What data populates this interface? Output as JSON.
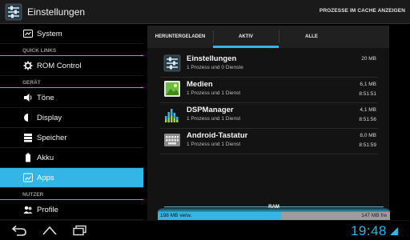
{
  "action_bar": {
    "title": "Einstellungen",
    "action_label": "PROZESSE IM CACHE ANZEIGEN"
  },
  "sidebar": {
    "items": [
      {
        "type": "item",
        "label": "System",
        "icon": "system-icon",
        "active": false
      },
      {
        "type": "header",
        "label": "QUICK LINKS"
      },
      {
        "type": "item",
        "label": "ROM Control",
        "icon": "gear-icon",
        "active": false
      },
      {
        "type": "header",
        "label": "GERÄT"
      },
      {
        "type": "item",
        "label": "Töne",
        "icon": "volume-icon",
        "active": false
      },
      {
        "type": "item",
        "label": "Display",
        "icon": "display-icon",
        "active": false
      },
      {
        "type": "item",
        "label": "Speicher",
        "icon": "storage-icon",
        "active": false
      },
      {
        "type": "item",
        "label": "Akku",
        "icon": "battery-icon",
        "active": false
      },
      {
        "type": "item",
        "label": "Apps",
        "icon": "apps-icon",
        "active": true
      },
      {
        "type": "header",
        "label": "NUTZER"
      },
      {
        "type": "item",
        "label": "Profile",
        "icon": "profile-icon",
        "active": false
      }
    ]
  },
  "tabs": [
    {
      "label": "HERUNTERGELADEN",
      "active": false
    },
    {
      "label": "AKTIV",
      "active": true
    },
    {
      "label": "ALLE",
      "active": false
    }
  ],
  "processes": [
    {
      "name": "Einstellungen",
      "sub": "1 Prozess und 0 Dienste",
      "size": "20 MB",
      "time": "",
      "icon": "settings-app-icon"
    },
    {
      "name": "Medien",
      "sub": "1 Prozess und 1 Dienst",
      "size": "6,1 MB",
      "time": "8:51:51",
      "icon": "media-app-icon"
    },
    {
      "name": "DSPManager",
      "sub": "1 Prozess und 1 Dienst",
      "size": "4,1 MB",
      "time": "8:51:56",
      "icon": "equalizer-app-icon"
    },
    {
      "name": "Android-Tastatur",
      "sub": "1 Prozess und 1 Dienst",
      "size": "8,0 MB",
      "time": "8:51:59",
      "icon": "keyboard-app-icon"
    }
  ],
  "ram": {
    "label": "RAM",
    "used_label": "198 MB verw.",
    "free_label": "147 MB fre",
    "used_fraction": 0.53
  },
  "navbar": {
    "clock": "19:48"
  },
  "colors": {
    "accent": "#33b5e5",
    "background": "#000000",
    "panel": "#131313"
  }
}
